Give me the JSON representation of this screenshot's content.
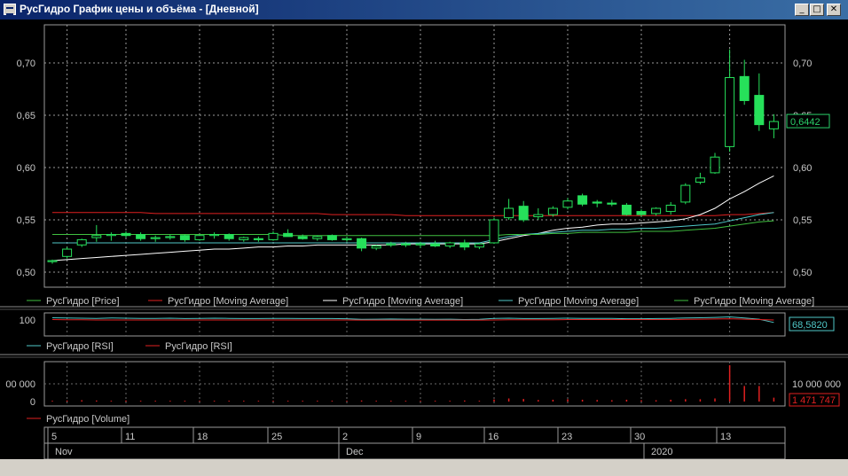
{
  "window": {
    "title": "РусГидро График цены и объёма - [Дневной]",
    "buttons": [
      "_",
      "□",
      "✕"
    ]
  },
  "chart_data": [
    {
      "type": "candlestick",
      "panel": "price",
      "ylim": [
        0.495,
        0.735
      ],
      "y_ticks": [
        "0,50",
        "0,55",
        "0,60",
        "0,65",
        "0,70"
      ],
      "last_value_label": "0,6442",
      "grid": true,
      "legend": [
        "РусГидро [Price]",
        "РусГидро [Moving Average]",
        "РусГидро [Moving Average]",
        "РусГидро [Moving Average]",
        "РусГидро [Moving Average]"
      ],
      "candles": [
        {
          "open": 0.51,
          "high": 0.512,
          "low": 0.508,
          "close": 0.511
        },
        {
          "open": 0.515,
          "high": 0.524,
          "low": 0.513,
          "close": 0.522
        },
        {
          "open": 0.526,
          "high": 0.532,
          "low": 0.524,
          "close": 0.531
        },
        {
          "open": 0.533,
          "high": 0.545,
          "low": 0.529,
          "close": 0.535
        },
        {
          "open": 0.535,
          "high": 0.538,
          "low": 0.53,
          "close": 0.536
        },
        {
          "open": 0.537,
          "high": 0.539,
          "low": 0.533,
          "close": 0.535
        },
        {
          "open": 0.536,
          "high": 0.538,
          "low": 0.53,
          "close": 0.532
        },
        {
          "open": 0.532,
          "high": 0.535,
          "low": 0.529,
          "close": 0.533
        },
        {
          "open": 0.533,
          "high": 0.536,
          "low": 0.531,
          "close": 0.534
        },
        {
          "open": 0.535,
          "high": 0.536,
          "low": 0.529,
          "close": 0.531
        },
        {
          "open": 0.531,
          "high": 0.536,
          "low": 0.53,
          "close": 0.535
        },
        {
          "open": 0.535,
          "high": 0.538,
          "low": 0.532,
          "close": 0.536
        },
        {
          "open": 0.536,
          "high": 0.537,
          "low": 0.53,
          "close": 0.532
        },
        {
          "open": 0.531,
          "high": 0.534,
          "low": 0.529,
          "close": 0.533
        },
        {
          "open": 0.532,
          "high": 0.534,
          "low": 0.529,
          "close": 0.531
        },
        {
          "open": 0.531,
          "high": 0.539,
          "low": 0.53,
          "close": 0.537
        },
        {
          "open": 0.537,
          "high": 0.541,
          "low": 0.534,
          "close": 0.534
        },
        {
          "open": 0.534,
          "high": 0.536,
          "low": 0.531,
          "close": 0.532
        },
        {
          "open": 0.532,
          "high": 0.535,
          "low": 0.53,
          "close": 0.534
        },
        {
          "open": 0.535,
          "high": 0.536,
          "low": 0.53,
          "close": 0.531
        },
        {
          "open": 0.531,
          "high": 0.534,
          "low": 0.529,
          "close": 0.532
        },
        {
          "open": 0.532,
          "high": 0.533,
          "low": 0.52,
          "close": 0.523
        },
        {
          "open": 0.523,
          "high": 0.526,
          "low": 0.521,
          "close": 0.525
        },
        {
          "open": 0.526,
          "high": 0.529,
          "low": 0.524,
          "close": 0.527
        },
        {
          "open": 0.527,
          "high": 0.529,
          "low": 0.524,
          "close": 0.526
        },
        {
          "open": 0.526,
          "high": 0.529,
          "low": 0.523,
          "close": 0.527
        },
        {
          "open": 0.527,
          "high": 0.53,
          "low": 0.524,
          "close": 0.525
        },
        {
          "open": 0.525,
          "high": 0.529,
          "low": 0.523,
          "close": 0.528
        },
        {
          "open": 0.528,
          "high": 0.531,
          "low": 0.521,
          "close": 0.524
        },
        {
          "open": 0.524,
          "high": 0.528,
          "low": 0.522,
          "close": 0.527
        },
        {
          "open": 0.528,
          "high": 0.552,
          "low": 0.527,
          "close": 0.55
        },
        {
          "open": 0.552,
          "high": 0.57,
          "low": 0.55,
          "close": 0.561
        },
        {
          "open": 0.563,
          "high": 0.568,
          "low": 0.548,
          "close": 0.55
        },
        {
          "open": 0.553,
          "high": 0.561,
          "low": 0.55,
          "close": 0.555
        },
        {
          "open": 0.555,
          "high": 0.563,
          "low": 0.553,
          "close": 0.561
        },
        {
          "open": 0.562,
          "high": 0.571,
          "low": 0.56,
          "close": 0.568
        },
        {
          "open": 0.573,
          "high": 0.575,
          "low": 0.563,
          "close": 0.565
        },
        {
          "open": 0.567,
          "high": 0.569,
          "low": 0.562,
          "close": 0.566
        },
        {
          "open": 0.566,
          "high": 0.569,
          "low": 0.563,
          "close": 0.565
        },
        {
          "open": 0.564,
          "high": 0.566,
          "low": 0.554,
          "close": 0.555
        },
        {
          "open": 0.558,
          "high": 0.56,
          "low": 0.553,
          "close": 0.555
        },
        {
          "open": 0.556,
          "high": 0.562,
          "low": 0.554,
          "close": 0.561
        },
        {
          "open": 0.558,
          "high": 0.567,
          "low": 0.555,
          "close": 0.564
        },
        {
          "open": 0.567,
          "high": 0.585,
          "low": 0.565,
          "close": 0.583
        },
        {
          "open": 0.586,
          "high": 0.595,
          "low": 0.584,
          "close": 0.59
        },
        {
          "open": 0.595,
          "high": 0.614,
          "low": 0.594,
          "close": 0.61
        },
        {
          "open": 0.62,
          "high": 0.713,
          "low": 0.615,
          "close": 0.686
        },
        {
          "open": 0.687,
          "high": 0.703,
          "low": 0.66,
          "close": 0.664
        },
        {
          "open": 0.669,
          "high": 0.69,
          "low": 0.635,
          "close": 0.641
        },
        {
          "open": 0.637,
          "high": 0.651,
          "low": 0.628,
          "close": 0.644
        }
      ],
      "ma_series": [
        {
          "color": "#e02020",
          "values": [
            0.557,
            0.557,
            0.557,
            0.557,
            0.557,
            0.557,
            0.557,
            0.556,
            0.556,
            0.556,
            0.556,
            0.556,
            0.556,
            0.556,
            0.556,
            0.556,
            0.556,
            0.556,
            0.556,
            0.555,
            0.555,
            0.555,
            0.555,
            0.555,
            0.554,
            0.554,
            0.554,
            0.554,
            0.554,
            0.554,
            0.554,
            0.554,
            0.554,
            0.554,
            0.554,
            0.554,
            0.554,
            0.554,
            0.554,
            0.554,
            0.554,
            0.554,
            0.554,
            0.554,
            0.554,
            0.554,
            0.555,
            0.555,
            0.556,
            0.557
          ]
        },
        {
          "color": "#ffffff",
          "values": [
            0.511,
            0.512,
            0.513,
            0.514,
            0.515,
            0.516,
            0.517,
            0.518,
            0.519,
            0.52,
            0.521,
            0.522,
            0.522,
            0.523,
            0.524,
            0.524,
            0.525,
            0.525,
            0.526,
            0.526,
            0.526,
            0.526,
            0.526,
            0.526,
            0.527,
            0.527,
            0.527,
            0.527,
            0.527,
            0.527,
            0.529,
            0.532,
            0.535,
            0.537,
            0.54,
            0.542,
            0.543,
            0.545,
            0.546,
            0.546,
            0.547,
            0.548,
            0.549,
            0.551,
            0.555,
            0.561,
            0.57,
            0.577,
            0.585,
            0.592
          ]
        },
        {
          "color": "#4fc8c8",
          "values": [
            0.528,
            0.528,
            0.528,
            0.528,
            0.528,
            0.528,
            0.528,
            0.528,
            0.528,
            0.528,
            0.528,
            0.528,
            0.528,
            0.528,
            0.528,
            0.528,
            0.528,
            0.528,
            0.528,
            0.528,
            0.528,
            0.528,
            0.528,
            0.528,
            0.528,
            0.528,
            0.528,
            0.528,
            0.528,
            0.528,
            0.531,
            0.534,
            0.536,
            0.537,
            0.538,
            0.539,
            0.54,
            0.54,
            0.541,
            0.541,
            0.542,
            0.542,
            0.543,
            0.544,
            0.545,
            0.546,
            0.549,
            0.552,
            0.555,
            0.557
          ]
        },
        {
          "color": "#40c040",
          "values": [
            0.536,
            0.536,
            0.536,
            0.536,
            0.536,
            0.536,
            0.536,
            0.536,
            0.536,
            0.536,
            0.536,
            0.536,
            0.536,
            0.536,
            0.536,
            0.536,
            0.535,
            0.535,
            0.535,
            0.535,
            0.535,
            0.535,
            0.535,
            0.535,
            0.535,
            0.535,
            0.535,
            0.535,
            0.535,
            0.535,
            0.535,
            0.536,
            0.536,
            0.536,
            0.537,
            0.537,
            0.538,
            0.538,
            0.538,
            0.538,
            0.539,
            0.539,
            0.539,
            0.54,
            0.541,
            0.542,
            0.544,
            0.546,
            0.548,
            0.549
          ]
        }
      ]
    },
    {
      "type": "line",
      "panel": "rsi",
      "ylim": [
        0,
        100
      ],
      "y_ticks": [
        "100"
      ],
      "last_value_label": "68,5820",
      "legend": [
        "РусГидро [RSI]",
        "РусГидро [RSI]"
      ],
      "series": [
        {
          "color": "#4fc8c8",
          "values": [
            93,
            92,
            91,
            90,
            92,
            91,
            90,
            90,
            91,
            89,
            90,
            91,
            90,
            89,
            89,
            90,
            90,
            89,
            89,
            89,
            88,
            85,
            86,
            87,
            86,
            86,
            85,
            86,
            84,
            85,
            90,
            91,
            89,
            89,
            90,
            91,
            90,
            90,
            90,
            88,
            88,
            89,
            90,
            92,
            93,
            95,
            98,
            92,
            86,
            69
          ]
        },
        {
          "color": "#e02020",
          "values": [
            84,
            83,
            83,
            82,
            82,
            82,
            82,
            82,
            82,
            82,
            82,
            82,
            82,
            82,
            82,
            82,
            82,
            82,
            82,
            82,
            82,
            81,
            81,
            81,
            81,
            81,
            81,
            81,
            81,
            81,
            82,
            83,
            83,
            83,
            83,
            84,
            84,
            84,
            84,
            84,
            84,
            84,
            84,
            85,
            86,
            87,
            88,
            86,
            84,
            82
          ]
        }
      ]
    },
    {
      "type": "bar",
      "panel": "volume",
      "ylim": [
        0,
        14000000
      ],
      "y_ticks": [
        "0",
        "10 000 000"
      ],
      "y_ticks_left_clipped": "00 000",
      "last_value_label": "1 471 747",
      "legend": [
        "РусГидро [Volume]"
      ],
      "values": [
        300000,
        400000,
        500000,
        400000,
        300000,
        400000,
        300000,
        300000,
        300000,
        300000,
        300000,
        300000,
        300000,
        300000,
        300000,
        300000,
        300000,
        300000,
        300000,
        300000,
        300000,
        400000,
        300000,
        300000,
        300000,
        300000,
        300000,
        300000,
        400000,
        300000,
        800000,
        1200000,
        1000000,
        600000,
        700000,
        900000,
        700000,
        600000,
        500000,
        700000,
        500000,
        500000,
        700000,
        900000,
        900000,
        1200000,
        14000000,
        6000000,
        6000000,
        1500000
      ]
    }
  ],
  "xaxis": {
    "day_labels": [
      "5",
      "11",
      "18",
      "25",
      "2",
      "9",
      "16",
      "23",
      "30",
      "13"
    ],
    "month_labels": [
      "Nov",
      "Dec",
      "2020"
    ]
  }
}
